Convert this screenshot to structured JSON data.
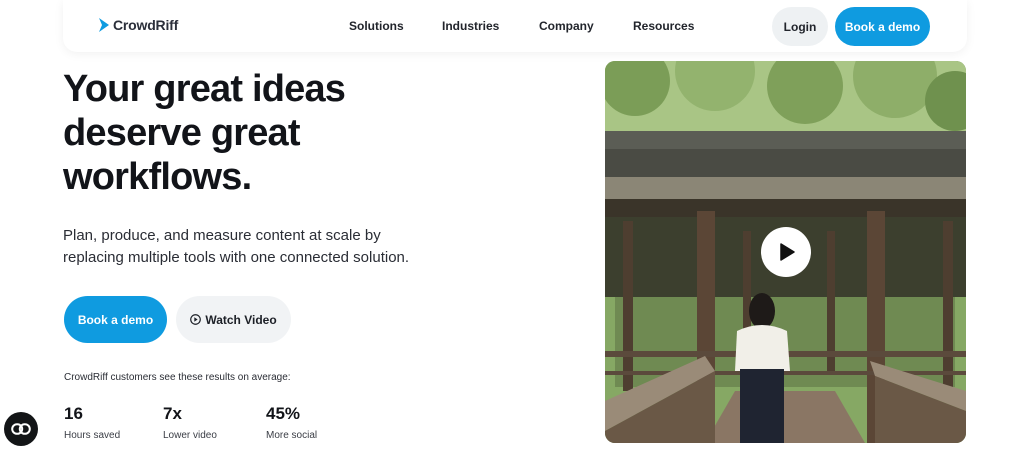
{
  "nav": {
    "logo_text": "CrowdRiff",
    "links": [
      "Solutions",
      "Industries",
      "Company",
      "Resources"
    ],
    "login_label": "Login",
    "demo_label": "Book a demo"
  },
  "hero": {
    "headline_line1": "Your great ideas",
    "headline_line2": "deserve great",
    "headline_line3": "workflows.",
    "subtext_line1": "Plan, produce, and measure content at scale by",
    "subtext_line2": "replacing multiple tools with one connected solution.",
    "primary_button": "Book a demo",
    "secondary_button": "Watch Video",
    "results_caption": "CrowdRiff customers see these results on average:",
    "stats": [
      {
        "value": "16",
        "label": "Hours saved"
      },
      {
        "value": "7x",
        "label": "Lower video"
      },
      {
        "value": "45%",
        "label": "More social"
      }
    ]
  },
  "colors": {
    "accent": "#0f9be0",
    "button_gray": "#f1f3f5",
    "text_dark": "#121419"
  },
  "icons": {
    "logo": "crowdriff-logo-mark",
    "play": "play-icon",
    "watch": "play-circle-icon",
    "accessibility": "accessibility-icon"
  }
}
